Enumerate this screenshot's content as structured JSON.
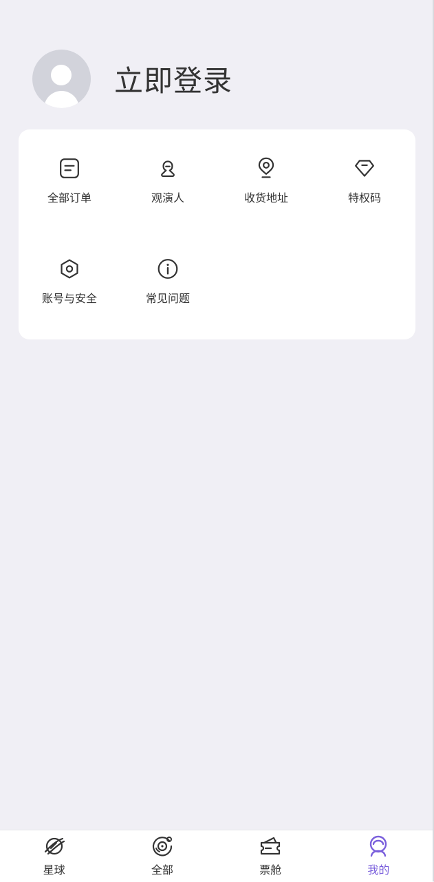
{
  "profile": {
    "login_text": "立即登录"
  },
  "menu": {
    "items": [
      {
        "label": "全部订单",
        "icon": "order-list-icon"
      },
      {
        "label": "观演人",
        "icon": "person-icon"
      },
      {
        "label": "收货地址",
        "icon": "location-pin-icon"
      },
      {
        "label": "特权码",
        "icon": "diamond-icon"
      },
      {
        "label": "账号与安全",
        "icon": "hexagon-nut-icon"
      },
      {
        "label": "常见问题",
        "icon": "info-icon"
      }
    ]
  },
  "tabbar": {
    "active": "我的",
    "active_color": "#7a5fdc",
    "items": [
      {
        "label": "星球",
        "icon": "planet-icon"
      },
      {
        "label": "全部",
        "icon": "all-disc-icon"
      },
      {
        "label": "票舱",
        "icon": "ticket-cabin-icon"
      },
      {
        "label": "我的",
        "icon": "profile-icon"
      }
    ]
  }
}
